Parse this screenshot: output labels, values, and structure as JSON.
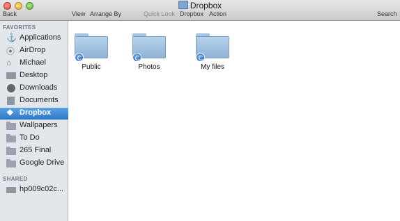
{
  "window": {
    "title": "Dropbox"
  },
  "toolbar": {
    "back": "Back",
    "view": "View",
    "arrange_by": "Arrange By",
    "quick_look": "Quick Look",
    "dropbox": "Dropbox",
    "action": "Action",
    "search": "Search"
  },
  "sidebar": {
    "favorites_header": "FAVORITES",
    "shared_header": "SHARED",
    "items": [
      {
        "label": "Applications",
        "icon": "applications-icon"
      },
      {
        "label": "AirDrop",
        "icon": "airdrop-icon"
      },
      {
        "label": "Michael",
        "icon": "home-icon"
      },
      {
        "label": "Desktop",
        "icon": "desktop-icon"
      },
      {
        "label": "Downloads",
        "icon": "downloads-icon"
      },
      {
        "label": "Documents",
        "icon": "documents-icon"
      },
      {
        "label": "Dropbox",
        "icon": "dropbox-icon",
        "selected": true
      },
      {
        "label": "Wallpapers",
        "icon": "folder-icon"
      },
      {
        "label": "To Do",
        "icon": "folder-icon"
      },
      {
        "label": "265 Final",
        "icon": "folder-icon"
      },
      {
        "label": "Google Drive",
        "icon": "folder-icon"
      }
    ],
    "shared": [
      {
        "label": "hp009c02c...",
        "icon": "computer-icon"
      }
    ]
  },
  "files": [
    {
      "name": "Public",
      "icon": "synced-folder-icon"
    },
    {
      "name": "Photos",
      "icon": "synced-folder-icon"
    },
    {
      "name": "My files",
      "icon": "synced-folder-icon"
    }
  ],
  "colors": {
    "selection": "#3a86d6",
    "folder": "#9cc0e3"
  }
}
